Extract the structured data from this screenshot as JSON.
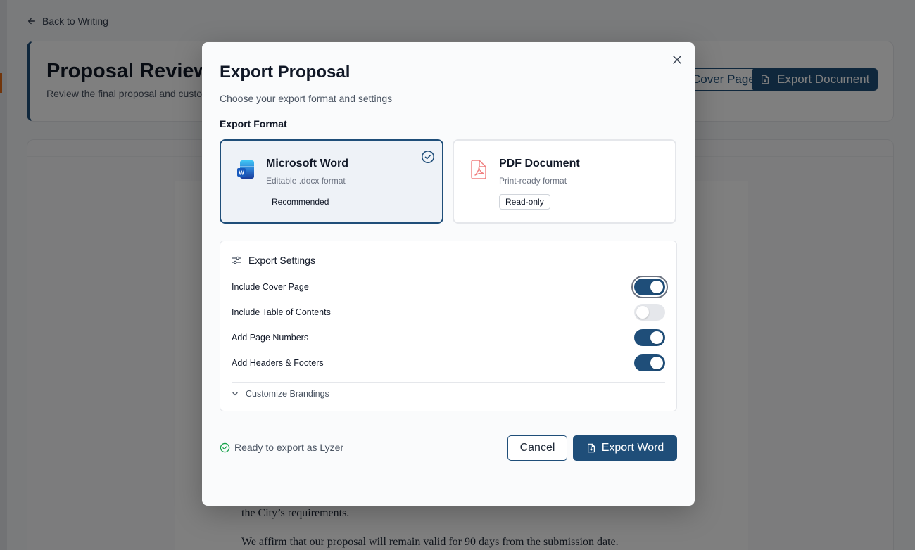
{
  "background": {
    "back_link": "Back to Writing",
    "header": {
      "title": "Proposal Review",
      "subtitle": "Review the final proposal and customize",
      "cover_button": "Cover Page",
      "export_button": "Export Document"
    },
    "paper": {
      "line1": "the City’s requirements.",
      "line2": "We affirm that our proposal will remain valid for 90 days from the submission date."
    }
  },
  "modal": {
    "title": "Export Proposal",
    "subtitle": "Choose your export format and settings",
    "format_label": "Export Format",
    "formats": [
      {
        "name": "Microsoft Word",
        "description": "Editable .docx format",
        "badge": "Recommended",
        "selected": true,
        "icon": "word-icon"
      },
      {
        "name": "PDF Document",
        "description": "Print-ready format",
        "badge": "Read-only",
        "selected": false,
        "icon": "pdf-icon"
      }
    ],
    "settings": {
      "title": "Export Settings",
      "items": [
        {
          "label": "Include Cover Page",
          "enabled": true
        },
        {
          "label": "Include Table of Contents",
          "enabled": false
        },
        {
          "label": "Add Page Numbers",
          "enabled": true
        },
        {
          "label": "Add Headers & Footers",
          "enabled": true
        }
      ],
      "customize_label": "Customize Brandings"
    },
    "status": "Ready to export as Lyzer",
    "cancel_label": "Cancel",
    "export_label": "Export Word"
  },
  "colors": {
    "primary": "#1f4e79",
    "success": "#16a34a",
    "pdf_red": "#f08080",
    "word_blue": "#185abd"
  }
}
